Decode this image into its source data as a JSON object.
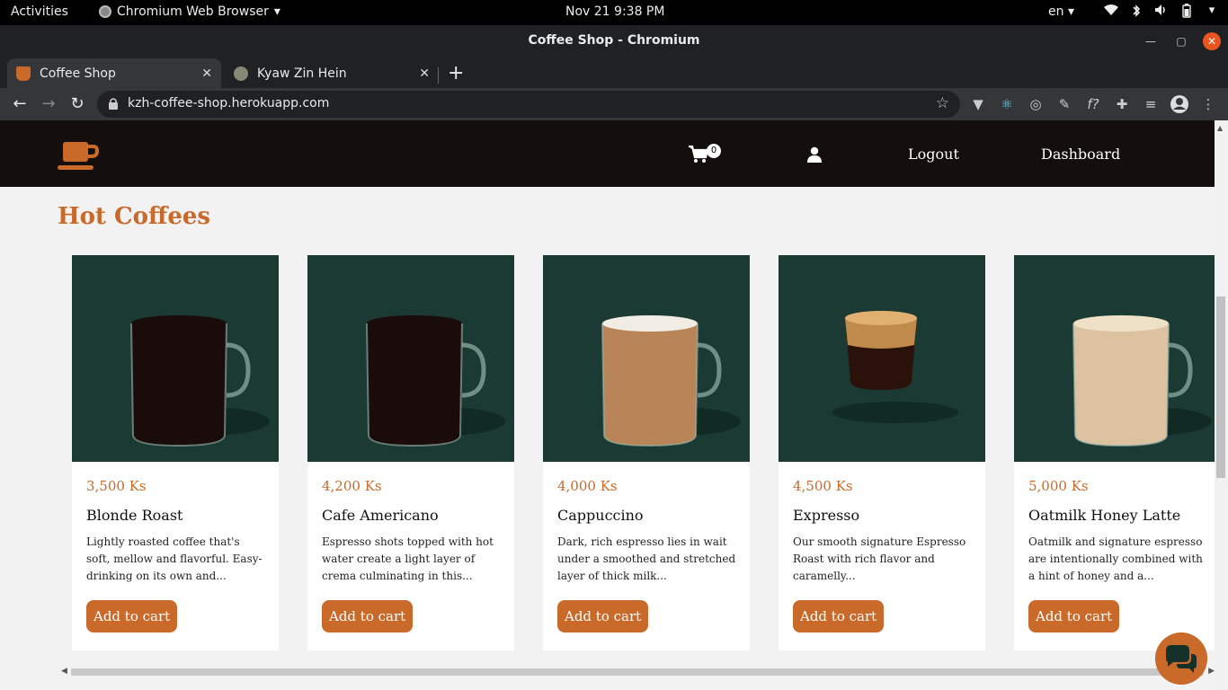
{
  "os_bar": {
    "activities": "Activities",
    "app_name": "Chromium Web Browser",
    "clock": "Nov 21  9:38 PM",
    "lang": "en",
    "tray_icons": [
      "wifi-icon",
      "bluetooth-icon",
      "volume-icon",
      "battery-icon",
      "power-menu-icon"
    ]
  },
  "window": {
    "title": "Coffee Shop - Chromium"
  },
  "tabs": [
    {
      "label": "Coffee Shop",
      "active": true
    },
    {
      "label": "Kyaw Zin Hein",
      "active": false
    }
  ],
  "address_bar": {
    "url": "kzh-coffee-shop.herokuapp.com"
  },
  "site_header": {
    "cart_count": "0",
    "logout": "Logout",
    "dashboard": "Dashboard"
  },
  "section": {
    "title": "Hot Coffees"
  },
  "products": [
    {
      "price": "3,500 Ks",
      "name": "Blonde Roast",
      "desc": "Lightly roasted coffee that's soft, mellow and flavorful. Easy-drinking on its own and...",
      "button": "Add to cart",
      "drink": "dark"
    },
    {
      "price": "4,200 Ks",
      "name": "Cafe Americano",
      "desc": "Espresso shots topped with hot water create a light layer of crema culminating in this...",
      "button": "Add to cart",
      "drink": "dark"
    },
    {
      "price": "4,000 Ks",
      "name": "Cappuccino",
      "desc": "Dark, rich espresso lies in wait under a smoothed and stretched layer of thick milk...",
      "button": "Add to cart",
      "drink": "latte"
    },
    {
      "price": "4,500 Ks",
      "name": "Expresso",
      "desc": "Our smooth signature Espresso Roast with rich flavor and caramelly...",
      "button": "Add to cart",
      "drink": "shot"
    },
    {
      "price": "5,000 Ks",
      "name": "Oatmilk Honey Latte",
      "desc": "Oatmilk and signature espresso are intentionally combined with a hint of honey and a...",
      "button": "Add to cart",
      "drink": "oat"
    }
  ],
  "colors": {
    "accent": "#c9692a",
    "header_bg": "#140f0c",
    "image_bg": "#1b3a33"
  }
}
